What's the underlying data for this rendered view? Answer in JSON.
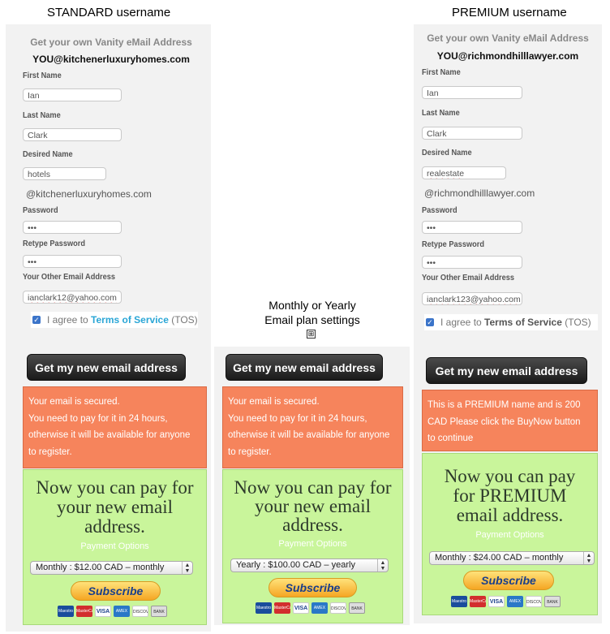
{
  "columns": {
    "standard": {
      "title": "STANDARD username",
      "vanity_title": "Get your own Vanity eMail Address",
      "vanity_address": "YOU@kitchenerluxuryhomes.com",
      "fields": {
        "first_name_label": "First Name",
        "first_name_value": "Ian",
        "last_name_label": "Last Name",
        "last_name_value": "Clark",
        "desired_name_label": "Desired Name",
        "desired_name_value": "hotels",
        "domain": "@kitchenerluxuryhomes.com",
        "password_label": "Password",
        "password_value": "•••",
        "retype_label": "Retype Password",
        "retype_value": "•••",
        "other_email_label": "Your Other Email Address",
        "other_email_value": "ianclark12@yahoo.com"
      },
      "tos": {
        "prefix": "I agree to ",
        "link": "Terms of Service",
        "suffix": " (TOS)",
        "link_color": "#2aa6d6"
      },
      "button_label": "Get my new email address",
      "notice": [
        "Your email is secured.",
        "You need to pay for it in 24 hours,",
        "otherwise it will be available for anyone",
        "to register."
      ],
      "pay_heading": [
        "Now you can pay for",
        "your new email",
        "address."
      ],
      "payment_options": "Payment Options",
      "plan_select": "Monthly : $12.00 CAD – monthly",
      "subscribe": "Subscribe"
    },
    "middle": {
      "label_line1": "Monthly or Yearly",
      "label_line2": "Email plan settings",
      "plus_icon": "⊞",
      "button_label": "Get my new email address",
      "notice": [
        "Your email is secured.",
        "You need to pay for it in 24 hours,",
        "otherwise it will be available for anyone",
        "to register."
      ],
      "pay_heading": [
        "Now you can pay for",
        "your new email",
        "address."
      ],
      "payment_options": "Payment Options",
      "plan_select": "Yearly : $100.00 CAD – yearly",
      "subscribe": "Subscribe"
    },
    "premium": {
      "title": "PREMIUM username",
      "vanity_title": "Get your own Vanity eMail Address",
      "vanity_address": "YOU@richmondhilllawyer.com",
      "fields": {
        "first_name_label": "First Name",
        "first_name_value": "Ian",
        "last_name_label": "Last Name",
        "last_name_value": "Clark",
        "desired_name_label": "Desired Name",
        "desired_name_value": "realestate",
        "domain": "@richmondhilllawyer.com",
        "password_label": "Password",
        "password_value": "•••",
        "retype_label": "Retype Password",
        "retype_value": "•••",
        "other_email_label": "Your Other Email Address",
        "other_email_value": "ianclark123@yahoo.com"
      },
      "tos": {
        "prefix": "I agree to ",
        "link": "Terms of Service",
        "suffix": " (TOS)",
        "link_color": "#555555"
      },
      "button_label": "Get my new email address",
      "notice": [
        "This is a PREMIUM name and is 200",
        "CAD Please click the BuyNow button",
        "to continue"
      ],
      "pay_heading": [
        "Now you can pay",
        "for PREMIUM",
        "email address."
      ],
      "payment_options": "Payment Options",
      "plan_select": "Monthly : $24.00 CAD – monthly",
      "subscribe": "Subscribe"
    }
  },
  "card_icons": [
    {
      "name": "maestro-card-icon",
      "label": "Maestro"
    },
    {
      "name": "mastercard-icon",
      "label": "MasterCard"
    },
    {
      "name": "visa-card-icon",
      "label": "VISA"
    },
    {
      "name": "amex-card-icon",
      "label": "AMEX"
    },
    {
      "name": "discover-card-icon",
      "label": "DISCOVER"
    },
    {
      "name": "bank-icon",
      "label": "BANK"
    }
  ],
  "colors": {
    "notice_bg": "#f6845c",
    "pay_bg": "#c9f59b",
    "button_bg": "#2b2b2b",
    "checkbox": "#3b74c9"
  }
}
